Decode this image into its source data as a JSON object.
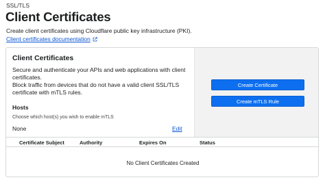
{
  "header": {
    "breadcrumb": "SSL/TLS",
    "title": "Client Certificates",
    "description": "Create client certificates using Cloudflare public key infrastructure (PKI).",
    "docs_link": "Client certificates documentation",
    "docs_icon": "external-link-icon"
  },
  "card": {
    "title": "Client Certificates",
    "description": "Secure and authenticate your APIs and web applications with client certificates.\nBlock traffic from devices that do not have a valid client SSL/TLS certificate with mTLS rules.",
    "desc_line1": "Secure and authenticate your APIs and web applications with client",
    "desc_line2": "certificates.",
    "desc_line3": "Block traffic from devices that do not have a valid client SSL/TLS",
    "desc_line4": "certificate with mTLS rules.",
    "hosts": {
      "title": "Hosts",
      "hint": "Choose which host(s) you wish to enable mTLS",
      "value": "None",
      "edit_label": "Edit"
    },
    "actions": {
      "create_certificate": "Create Certificate",
      "create_mtls_rule": "Create mTLS Rule"
    }
  },
  "table": {
    "columns": [
      "Certificate Subject",
      "Authority",
      "Expires On",
      "Status"
    ],
    "empty_message": "No Client Certificates Created"
  },
  "colors": {
    "accent": "#0d6ff0",
    "link": "#0a55d6",
    "panel_bg": "#f2f2f2"
  }
}
